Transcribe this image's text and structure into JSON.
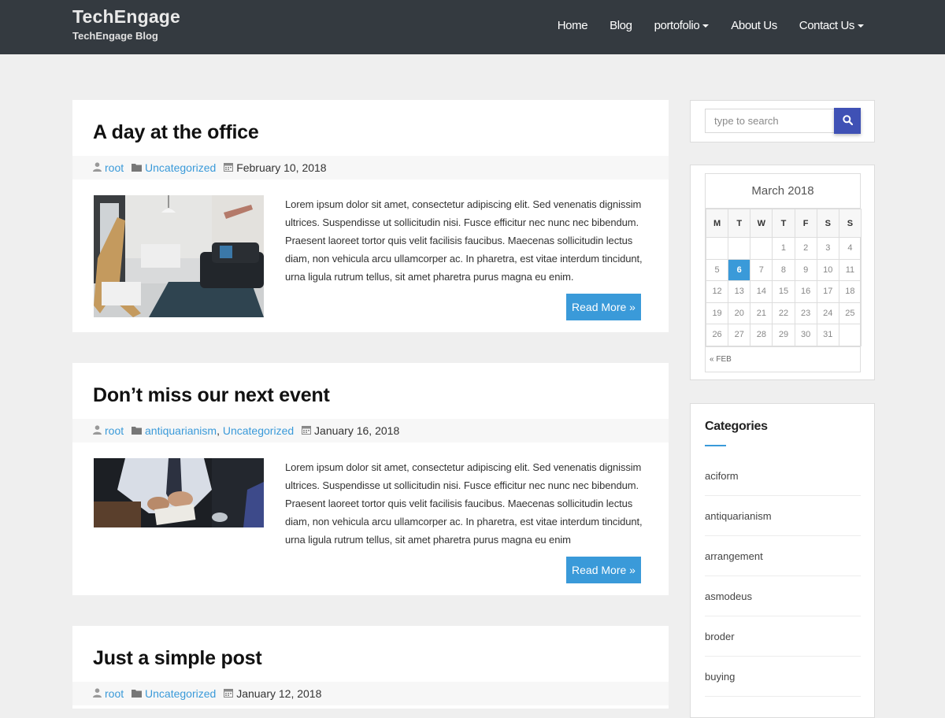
{
  "site": {
    "title": "TechEngage",
    "tagline": "TechEngage Blog"
  },
  "nav": {
    "home": "Home",
    "blog": "Blog",
    "portfolio": "portofolio",
    "about": "About Us",
    "contact": "Contact Us"
  },
  "posts": [
    {
      "title": "A day at the office",
      "author": "root",
      "categories": [
        "Uncategorized"
      ],
      "date": "February 10, 2018",
      "excerpt": "Lorem ipsum dolor sit amet, consectetur adipiscing elit. Sed venenatis dignissim ultrices. Suspendisse ut sollicitudin nisi. Fusce efficitur nec nunc nec bibendum. Praesent laoreet tortor quis velit facilisis faucibus. Maecenas sollicitudin lectus diam, non vehicula arcu ullamcorper ac. In pharetra, est vitae interdum tincidunt, urna ligula rutrum tellus, sit amet pharetra purus magna eu enim.",
      "read_more": "Read More »"
    },
    {
      "title": "Don’t miss our next event",
      "author": "root",
      "categories": [
        "antiquarianism",
        "Uncategorized"
      ],
      "category_separator": ", ",
      "date": "January 16, 2018",
      "excerpt": "Lorem ipsum dolor sit amet, consectetur adipiscing elit. Sed venenatis dignissim ultrices. Suspendisse ut sollicitudin nisi. Fusce efficitur nec nunc nec bibendum. Praesent laoreet tortor quis velit facilisis faucibus. Maecenas sollicitudin lectus diam, non vehicula arcu ullamcorper ac. In pharetra, est vitae interdum tincidunt, urna ligula rutrum tellus, sit amet pharetra purus magna eu enim",
      "read_more": "Read More »"
    },
    {
      "title": "Just a simple post",
      "author": "root",
      "categories": [
        "Uncategorized"
      ],
      "date": "January 12, 2018"
    }
  ],
  "search": {
    "placeholder": "type to search"
  },
  "calendar": {
    "caption": "March 2018",
    "weekdays": [
      "M",
      "T",
      "W",
      "T",
      "F",
      "S",
      "S"
    ],
    "rows": [
      [
        "",
        "",
        "",
        "1",
        "2",
        "3",
        "4"
      ],
      [
        "5",
        "6",
        "7",
        "8",
        "9",
        "10",
        "11"
      ],
      [
        "12",
        "13",
        "14",
        "15",
        "16",
        "17",
        "18"
      ],
      [
        "19",
        "20",
        "21",
        "22",
        "23",
        "24",
        "25"
      ],
      [
        "26",
        "27",
        "28",
        "29",
        "30",
        "31",
        ""
      ]
    ],
    "today": "6",
    "prev_link": "« FEB"
  },
  "categories_widget": {
    "title": "Categories",
    "items": [
      "aciform",
      "antiquarianism",
      "arrangement",
      "asmodeus",
      "broder",
      "buying"
    ]
  },
  "colors": {
    "header_bg": "#343a40",
    "accent": "#3a9ad9",
    "search_button": "#3f51b5",
    "page_bg": "#efefef"
  }
}
